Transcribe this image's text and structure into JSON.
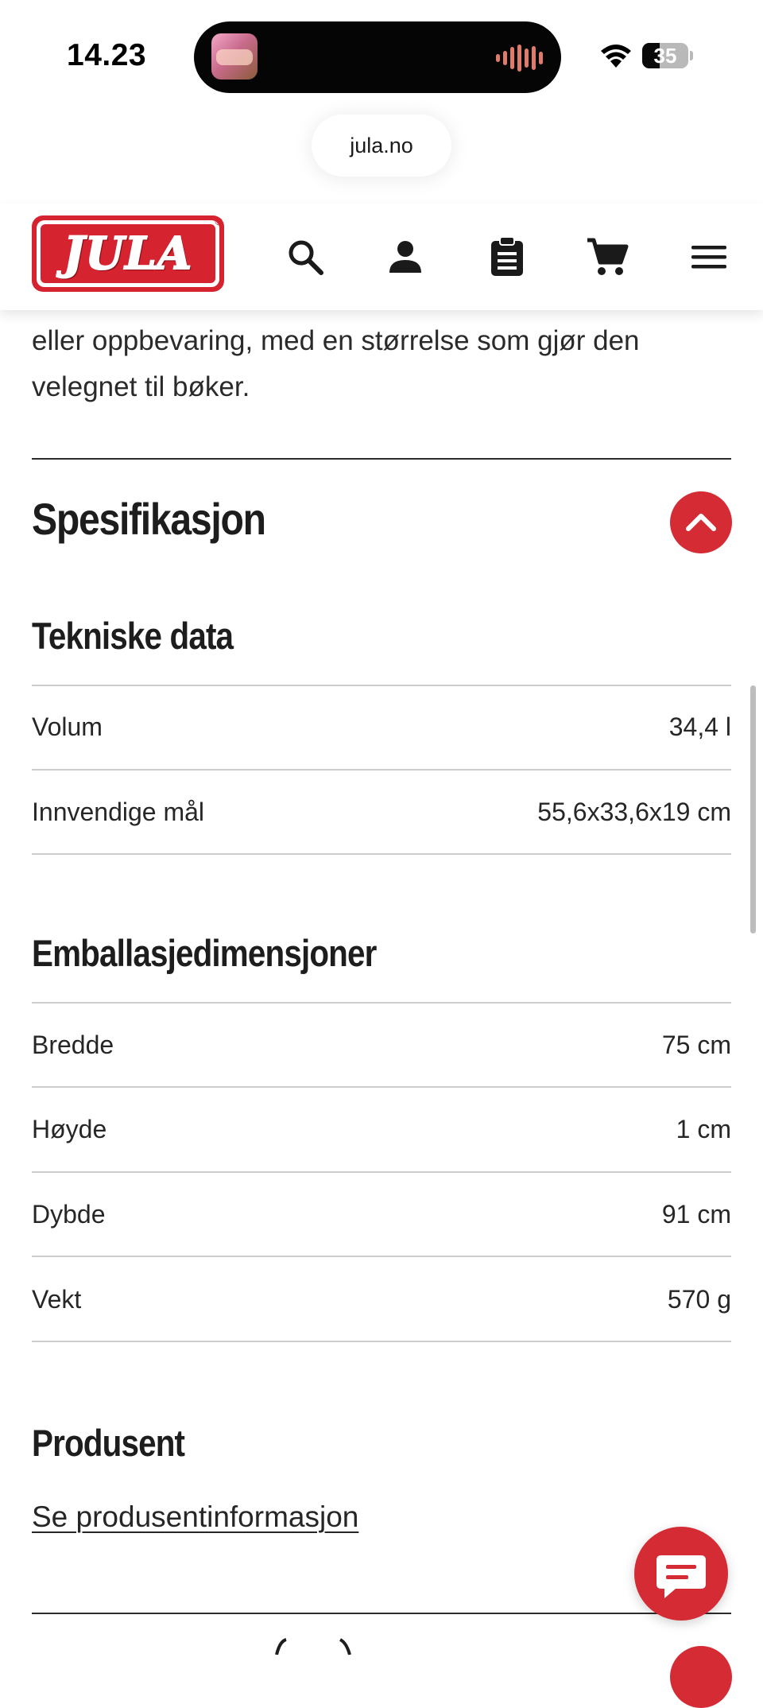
{
  "status_bar": {
    "time": "14.23",
    "battery": "35"
  },
  "browser": {
    "url": "jula.no"
  },
  "header": {
    "logo_text": "JULA",
    "logo_mark": "®"
  },
  "description": {
    "lines": [
      "eller oppbevaring, med en størrelse som gjør den",
      "velegnet til bøker."
    ]
  },
  "specification": {
    "title": "Spesifikasjon",
    "technical": {
      "title": "Tekniske data",
      "rows": [
        {
          "label": "Volum",
          "value": "34,4 l"
        },
        {
          "label": "Innvendige mål",
          "value": "55,6x33,6x19 cm"
        }
      ]
    },
    "packaging": {
      "title": "Emballasjedimensjoner",
      "rows": [
        {
          "label": "Bredde",
          "value": "75 cm"
        },
        {
          "label": "Høyde",
          "value": "1 cm"
        },
        {
          "label": "Dybde",
          "value": "91 cm"
        },
        {
          "label": "Vekt",
          "value": "570 g"
        }
      ]
    },
    "manufacturer": {
      "title": "Produsent",
      "link": "Se produsentinformasjon"
    }
  },
  "colors": {
    "brand_red": "#d52b35",
    "text": "#262626"
  }
}
